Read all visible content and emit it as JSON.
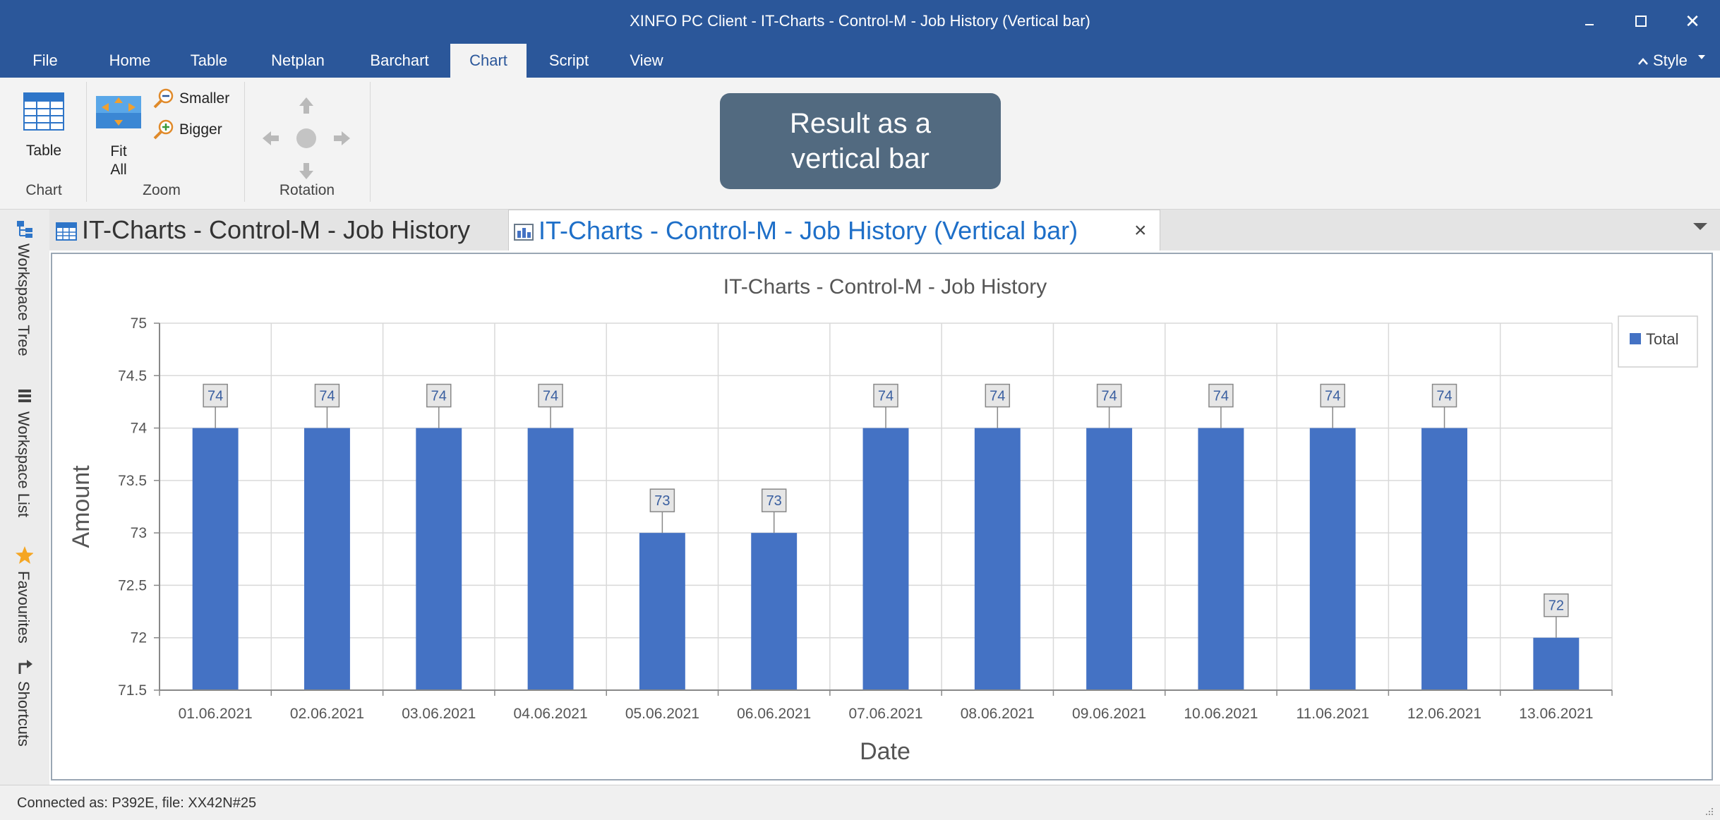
{
  "window": {
    "title": "XINFO PC Client - IT-Charts - Control-M - Job History (Vertical bar)",
    "minimize_icon": "minimize-icon",
    "maximize_icon": "maximize-icon",
    "close_label": "✕"
  },
  "menu": {
    "tabs": [
      {
        "label": "File"
      },
      {
        "label": "Home"
      },
      {
        "label": "Table"
      },
      {
        "label": "Netplan"
      },
      {
        "label": "Barchart"
      },
      {
        "label": "Chart",
        "active": true
      },
      {
        "label": "Script"
      },
      {
        "label": "View"
      }
    ],
    "style_label": "Style"
  },
  "ribbon": {
    "groups": {
      "chart": {
        "label": "Chart",
        "table_button": "Table"
      },
      "zoom": {
        "label": "Zoom",
        "fit_all_line1": "Fit",
        "fit_all_line2": "All",
        "smaller": "Smaller",
        "bigger": "Bigger"
      },
      "rotation": {
        "label": "Rotation"
      }
    }
  },
  "callout": {
    "line1": "Result as a",
    "line2": "vertical bar"
  },
  "doc_tabs": [
    {
      "label": "IT-Charts - Control-M - Job History"
    },
    {
      "label": "IT-Charts - Control-M - Job History (Vertical bar)",
      "active": true
    }
  ],
  "doc_tab_close": "×",
  "side_dock": [
    {
      "label": "Workspace Tree",
      "icon": "tree-icon"
    },
    {
      "label": "Workspace List",
      "icon": "list-icon"
    },
    {
      "label": "Favourites",
      "icon": "star-icon"
    },
    {
      "label": "Shortcuts",
      "icon": "shortcut-arrow-icon"
    }
  ],
  "colors": {
    "accent": "#2b579a",
    "bar": "#4472c4",
    "star": "#f5a623"
  },
  "chart_data": {
    "type": "bar",
    "title": "IT-Charts - Control-M - Job History",
    "xlabel": "Date",
    "ylabel": "Amount",
    "categories": [
      "01.06.2021",
      "02.06.2021",
      "03.06.2021",
      "04.06.2021",
      "05.06.2021",
      "06.06.2021",
      "07.06.2021",
      "08.06.2021",
      "09.06.2021",
      "10.06.2021",
      "11.06.2021",
      "12.06.2021",
      "13.06.2021"
    ],
    "series": [
      {
        "name": "Total",
        "values": [
          74,
          74,
          74,
          74,
          73,
          73,
          74,
          74,
          74,
          74,
          74,
          74,
          72
        ]
      }
    ],
    "data_labels": [
      "74",
      "74",
      "74",
      "74",
      "73",
      "73",
      "74",
      "74",
      "74",
      "74",
      "74",
      "74",
      "72"
    ],
    "ylim": [
      71.5,
      75
    ],
    "yticks": [
      "71.5",
      "72",
      "72.5",
      "73",
      "73.5",
      "74",
      "74.5",
      "75"
    ],
    "grid": true,
    "legend": "top-right"
  },
  "status": {
    "text": "Connected as: P392E, file: XX42N#25"
  }
}
